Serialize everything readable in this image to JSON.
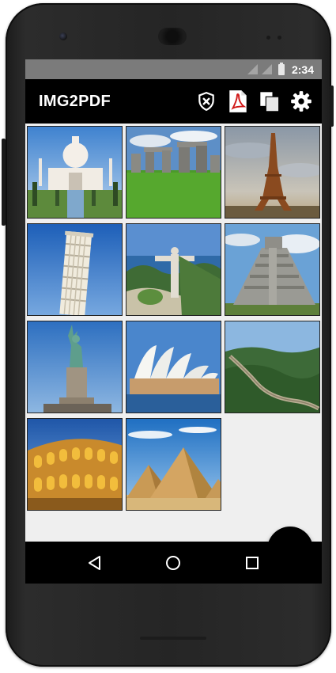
{
  "status_bar": {
    "time": "2:34",
    "icons": [
      "signal-icon",
      "signal-icon",
      "battery-icon"
    ]
  },
  "app_bar": {
    "title": "IMG2PDF",
    "actions": [
      {
        "name": "shield-x-icon"
      },
      {
        "name": "pdf-icon"
      },
      {
        "name": "copy-pages-icon"
      },
      {
        "name": "gear-icon"
      }
    ]
  },
  "gallery": {
    "images": [
      {
        "name": "taj-mahal-image"
      },
      {
        "name": "stonehenge-image"
      },
      {
        "name": "eiffel-tower-image"
      },
      {
        "name": "leaning-tower-pisa-image"
      },
      {
        "name": "christ-the-redeemer-image"
      },
      {
        "name": "chichen-itza-image"
      },
      {
        "name": "statue-of-liberty-image"
      },
      {
        "name": "sydney-opera-house-image"
      },
      {
        "name": "great-wall-image"
      },
      {
        "name": "colosseum-image"
      },
      {
        "name": "pyramids-giza-image"
      }
    ]
  },
  "fab": {
    "icon": "plus-icon"
  },
  "nav_bar": {
    "buttons": [
      "back-icon",
      "home-icon",
      "recents-icon"
    ]
  }
}
